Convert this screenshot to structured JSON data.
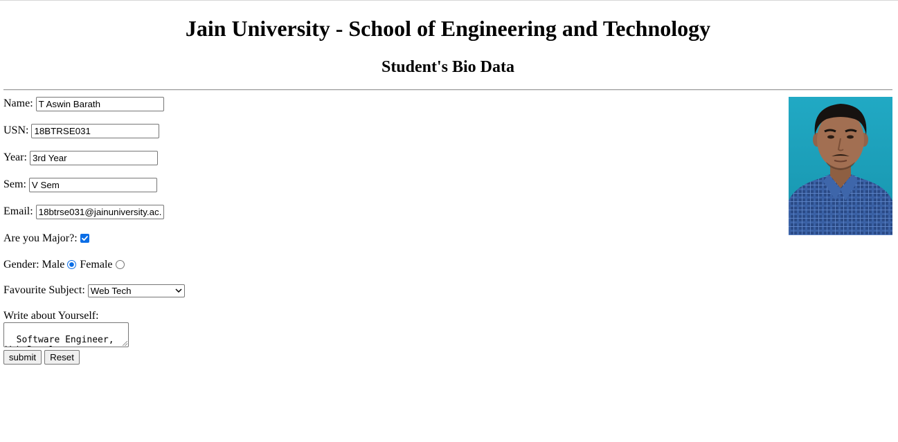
{
  "header": {
    "title": "Jain University - School of Engineering and Technology",
    "subtitle": "Student's Bio Data"
  },
  "form": {
    "name": {
      "label": "Name:",
      "value": "T Aswin Barath"
    },
    "usn": {
      "label": "USN:",
      "value": "18BTRSE031"
    },
    "year": {
      "label": "Year:",
      "value": "3rd Year"
    },
    "sem": {
      "label": "Sem:",
      "value": "V Sem"
    },
    "email": {
      "label": "Email:",
      "value": "18btrse031@jainuniversity.ac."
    },
    "major": {
      "label": "Are you Major?:",
      "checked": true
    },
    "gender": {
      "label": "Gender:",
      "options": [
        {
          "label": "Male",
          "selected": true
        },
        {
          "label": "Female",
          "selected": false
        }
      ]
    },
    "favourite_subject": {
      "label": "Favourite Subject:",
      "value": "Web Tech"
    },
    "about": {
      "label": "Write about Yourself:",
      "value": "Software Engineer,\nWeb Developer"
    },
    "submit_label": "submit",
    "reset_label": "Reset"
  },
  "colors": {
    "accent": "#0b6ee6",
    "photo_background": "#1aa3bf"
  }
}
